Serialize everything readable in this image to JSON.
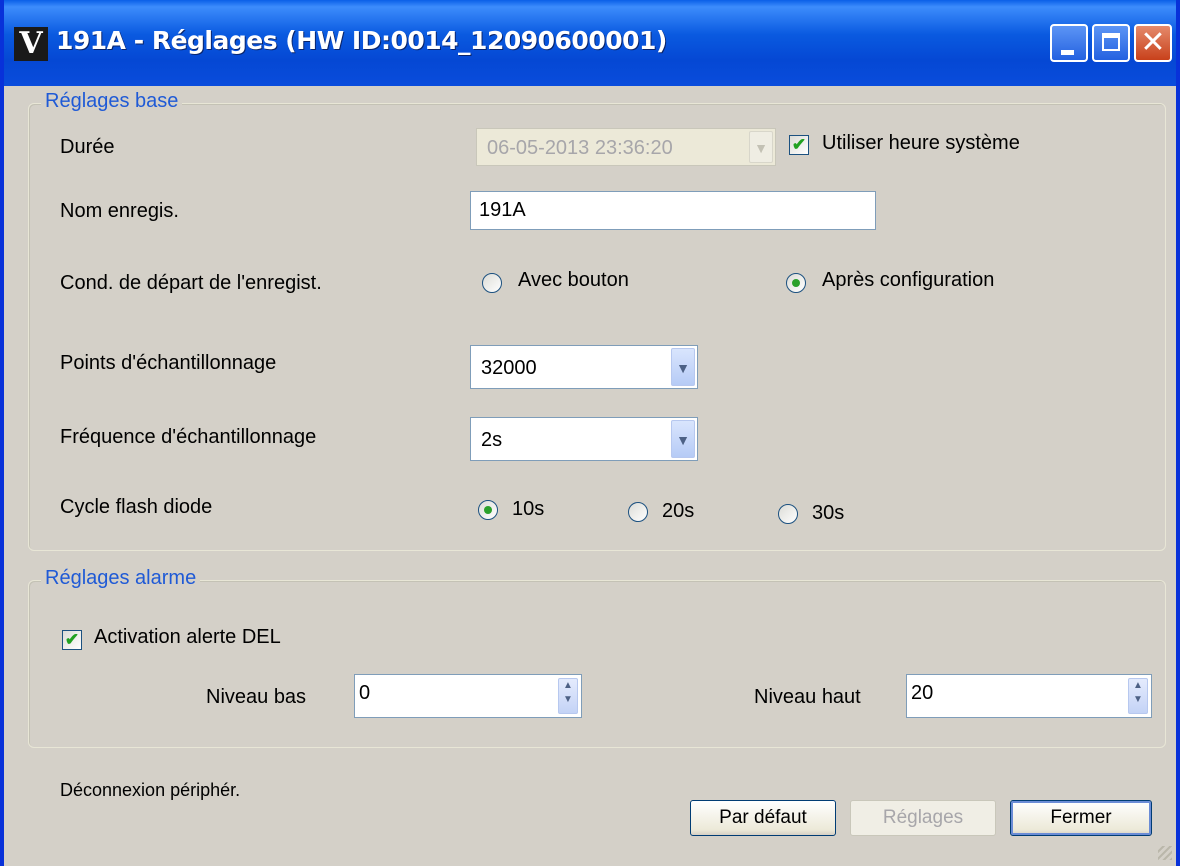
{
  "window": {
    "title": "191A - Réglages (HW ID:0014_12090600001)",
    "app_icon": "V"
  },
  "base": {
    "group_title": "Réglages base",
    "duration_label": "Durée",
    "duration_value": "06-05-2013 23:36:20",
    "use_system_time_label": "Utiliser heure système",
    "use_system_time_checked": true,
    "name_label": "Nom enregis.",
    "name_value": "191A",
    "start_cond_label": "Cond. de départ de l'enregist.",
    "start_options": [
      "Avec bouton",
      "Après configuration"
    ],
    "start_selected": "Après configuration",
    "points_label": "Points d'échantillonnage",
    "points_value": "32000",
    "freq_label": "Fréquence d'échantillonnage",
    "freq_value": "2s",
    "flash_label": "Cycle flash diode",
    "flash_options": [
      "10s",
      "20s",
      "30s"
    ],
    "flash_selected": "10s"
  },
  "alarm": {
    "group_title": "Réglages alarme",
    "led_alert_label": "Activation alerte DEL",
    "led_alert_checked": true,
    "low_label": "Niveau bas",
    "low_value": "0",
    "high_label": "Niveau haut",
    "high_value": "20"
  },
  "footer": {
    "status": "Déconnexion périphér.",
    "default_button": "Par défaut",
    "settings_button": "Réglages",
    "close_button": "Fermer"
  },
  "colors": {
    "titlebar": "#0a5ae0",
    "dialog_bg": "#d4d0c8",
    "group_title": "#1f5ad6",
    "check_mark": "#21a121"
  },
  "icons": {
    "dropdown": "▼",
    "check": "✔",
    "close": "✕",
    "spin_up": "▲",
    "spin_down": "▼"
  }
}
